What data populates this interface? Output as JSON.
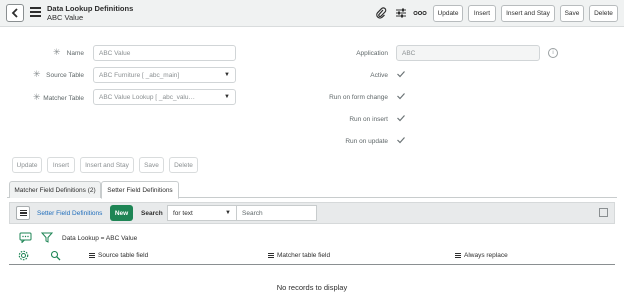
{
  "header": {
    "title": "Data Lookup Definitions",
    "subtitle": "ABC Value",
    "buttons": [
      "Update",
      "Insert",
      "Insert and Stay",
      "Save",
      "Delete"
    ]
  },
  "form": {
    "name_label": "Name",
    "name_value": "ABC Value",
    "source_table_label": "Source Table",
    "source_table_value": "ABC Furniture [                 _abc_main]",
    "matcher_table_label": "Matcher Table",
    "matcher_table_value": "ABC Value Lookup [                _abc_valu…",
    "application_label": "Application",
    "application_value": "ABC",
    "active_label": "Active",
    "run_on_form_change_label": "Run on form change",
    "run_on_insert_label": "Run on insert",
    "run_on_update_label": "Run on update",
    "buttons": [
      "Update",
      "Insert",
      "Insert and Stay",
      "Save",
      "Delete"
    ]
  },
  "tabs": [
    {
      "label": "Matcher Field Definitions (2)",
      "active": false
    },
    {
      "label": "Setter Field Definitions",
      "active": true
    }
  ],
  "related_list": {
    "title": "Setter Field Definitions",
    "new_label": "New",
    "search_label": "Search",
    "search_field": "for text",
    "search_placeholder": "Search",
    "filter": "Data Lookup = ABC Value",
    "columns": [
      "Source table field",
      "Matcher table field",
      "Always replace"
    ],
    "empty_message": "No records to display"
  },
  "colors": {
    "new_button": "#1e8555",
    "link": "#1f6dbb"
  }
}
